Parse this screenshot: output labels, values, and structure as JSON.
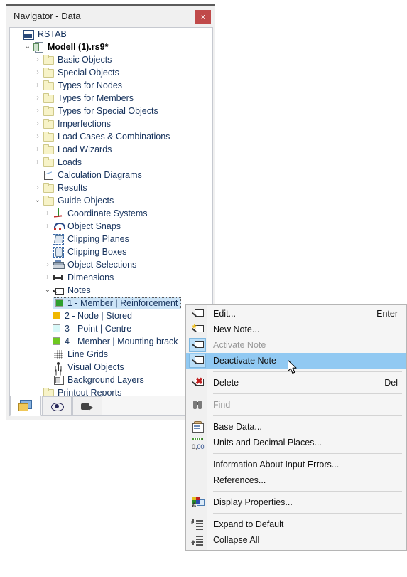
{
  "window": {
    "title": "Navigator - Data",
    "close_label": "x"
  },
  "tree": {
    "items": [
      {
        "label": "RSTAB",
        "indent": 0,
        "chevron": "none",
        "icon": "rstab-icon",
        "bold": false
      },
      {
        "label": "Modell (1).rs9*",
        "indent": 1,
        "chevron": "down",
        "icon": "document-icon",
        "bold": true
      },
      {
        "label": "Basic Objects",
        "indent": 2,
        "chevron": "right",
        "icon": "folder-icon",
        "bold": false
      },
      {
        "label": "Special Objects",
        "indent": 2,
        "chevron": "right",
        "icon": "folder-icon",
        "bold": false
      },
      {
        "label": "Types for Nodes",
        "indent": 2,
        "chevron": "right",
        "icon": "folder-icon",
        "bold": false
      },
      {
        "label": "Types for Members",
        "indent": 2,
        "chevron": "right",
        "icon": "folder-icon",
        "bold": false
      },
      {
        "label": "Types for Special Objects",
        "indent": 2,
        "chevron": "right",
        "icon": "folder-icon",
        "bold": false
      },
      {
        "label": "Imperfections",
        "indent": 2,
        "chevron": "right",
        "icon": "folder-icon",
        "bold": false
      },
      {
        "label": "Load Cases & Combinations",
        "indent": 2,
        "chevron": "right",
        "icon": "folder-icon",
        "bold": false
      },
      {
        "label": "Load Wizards",
        "indent": 2,
        "chevron": "right",
        "icon": "folder-icon",
        "bold": false
      },
      {
        "label": "Loads",
        "indent": 2,
        "chevron": "right",
        "icon": "folder-icon",
        "bold": false
      },
      {
        "label": "Calculation Diagrams",
        "indent": 2,
        "chevron": "none",
        "icon": "diagram-icon",
        "bold": false
      },
      {
        "label": "Results",
        "indent": 2,
        "chevron": "right",
        "icon": "folder-icon",
        "bold": false
      },
      {
        "label": "Guide Objects",
        "indent": 2,
        "chevron": "down",
        "icon": "folder-icon",
        "bold": false
      },
      {
        "label": "Coordinate Systems",
        "indent": 3,
        "chevron": "right",
        "icon": "coordinate-systems-icon",
        "bold": false
      },
      {
        "label": "Object Snaps",
        "indent": 3,
        "chevron": "right",
        "icon": "magnet-icon",
        "bold": false
      },
      {
        "label": "Clipping Planes",
        "indent": 3,
        "chevron": "none",
        "icon": "clipping-plane-icon",
        "bold": false
      },
      {
        "label": "Clipping Boxes",
        "indent": 3,
        "chevron": "none",
        "icon": "clipping-box-icon",
        "bold": false
      },
      {
        "label": "Object Selections",
        "indent": 3,
        "chevron": "right",
        "icon": "object-selection-icon",
        "bold": false
      },
      {
        "label": "Dimensions",
        "indent": 3,
        "chevron": "right",
        "icon": "dimension-icon",
        "bold": false
      },
      {
        "label": "Notes",
        "indent": 3,
        "chevron": "down",
        "icon": "note-icon",
        "bold": false
      }
    ],
    "notes": [
      {
        "label": "1 - Member | Reinforcement",
        "color": "#2ea02e",
        "selected": true
      },
      {
        "label": "2 - Node | Stored",
        "color": "#f0b800",
        "selected": false
      },
      {
        "label": "3 - Point | Centre",
        "color": "#d8f8f8",
        "selected": false
      },
      {
        "label": "4 - Member | Mounting brack",
        "color": "#6ec820",
        "selected": false
      }
    ],
    "trailing": [
      {
        "label": "Line Grids",
        "indent": 3,
        "chevron": "none",
        "icon": "line-grid-icon"
      },
      {
        "label": "Visual Objects",
        "indent": 3,
        "chevron": "none",
        "icon": "person-icon"
      },
      {
        "label": "Background Layers",
        "indent": 3,
        "chevron": "none",
        "icon": "background-layer-icon"
      },
      {
        "label": "Printout Reports",
        "indent": 2,
        "chevron": "none",
        "icon": "folder-icon"
      }
    ]
  },
  "tabs": [
    {
      "name": "data",
      "icon": "data-tab-icon",
      "active": true
    },
    {
      "name": "display",
      "icon": "eye-icon",
      "active": false
    },
    {
      "name": "views",
      "icon": "camera-icon",
      "active": false
    }
  ],
  "context_menu": {
    "items": [
      {
        "label": "Edit...",
        "shortcut": "Enter",
        "icon": "note-edit-icon",
        "state": "normal",
        "type": "item"
      },
      {
        "label": "New Note...",
        "shortcut": "",
        "icon": "note-new-icon",
        "state": "normal",
        "type": "item"
      },
      {
        "label": "Activate Note",
        "shortcut": "",
        "icon": "note-activate-icon",
        "state": "disabled",
        "type": "item"
      },
      {
        "label": "Deactivate Note",
        "shortcut": "",
        "icon": "note-deactivate-icon",
        "state": "highlight",
        "type": "item"
      },
      {
        "type": "separator"
      },
      {
        "label": "Delete",
        "shortcut": "Del",
        "icon": "note-delete-icon",
        "state": "normal",
        "type": "item"
      },
      {
        "type": "separator"
      },
      {
        "label": "Find",
        "shortcut": "",
        "icon": "binoculars-icon",
        "state": "disabled",
        "type": "item"
      },
      {
        "type": "separator"
      },
      {
        "label": "Base Data...",
        "shortcut": "",
        "icon": "base-data-icon",
        "state": "normal",
        "type": "item"
      },
      {
        "label": "Units and Decimal Places...",
        "shortcut": "",
        "icon": "units-icon",
        "state": "normal",
        "type": "item"
      },
      {
        "type": "separator"
      },
      {
        "label": "Information About Input Errors...",
        "shortcut": "",
        "icon": "",
        "state": "normal",
        "type": "item"
      },
      {
        "label": "References...",
        "shortcut": "",
        "icon": "",
        "state": "normal",
        "type": "item"
      },
      {
        "type": "separator"
      },
      {
        "label": "Display Properties...",
        "shortcut": "",
        "icon": "display-properties-icon",
        "state": "normal",
        "type": "item"
      },
      {
        "type": "separator"
      },
      {
        "label": "Expand to Default",
        "shortcut": "",
        "icon": "expand-icon",
        "state": "normal",
        "type": "item"
      },
      {
        "label": "Collapse All",
        "shortcut": "",
        "icon": "collapse-icon",
        "state": "normal",
        "type": "item"
      }
    ]
  },
  "colors": {
    "highlight": "#91c9f2",
    "selection": "#cce4f7",
    "close_button": "#c04a4a",
    "tree_text": "#16325c"
  }
}
